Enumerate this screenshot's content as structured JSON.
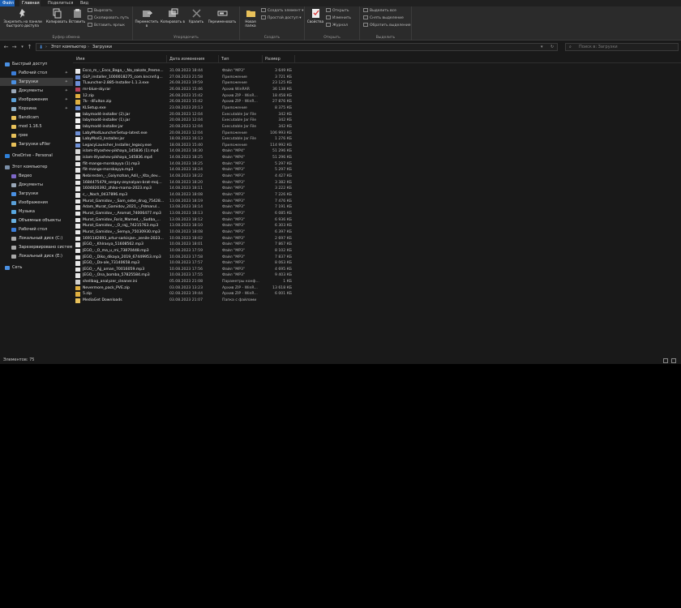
{
  "ribbon_tabs": [
    "Файл",
    "Главная",
    "Поделиться",
    "Вид"
  ],
  "ribbon": {
    "clipboard": {
      "pin_label": "Закрепить на панели быстрого доступа",
      "copy_label": "Копировать",
      "paste_label": "Вставить",
      "cut_label": "Вырезать",
      "copy_path_label": "Скопировать путь",
      "paste_shortcut_label": "Вставить ярлык",
      "group_label": "Буфер обмена"
    },
    "organize": {
      "move_label": "Переместить в",
      "copy_to_label": "Копировать в",
      "delete_label": "Удалить",
      "rename_label": "Переименовать",
      "group_label": "Упорядочить"
    },
    "new": {
      "new_folder_label": "Новая папка",
      "new_item_label": "Создать элемент",
      "easy_access_label": "Простой доступ",
      "group_label": "Создать"
    },
    "open": {
      "properties_label": "Свойства",
      "open_label": "Открыть",
      "edit_label": "Изменить",
      "history_label": "Журнал",
      "group_label": "Открыть"
    },
    "select": {
      "select_all_label": "Выделить все",
      "select_none_label": "Снять выделение",
      "invert_label": "Обратить выделение",
      "group_label": "Выделить"
    }
  },
  "address": {
    "path": [
      "Этот компьютер",
      "Загрузки"
    ],
    "search_placeholder": "Поиск в: Загрузки"
  },
  "nav": {
    "items": [
      {
        "label": "Быстрый доступ",
        "pinned": false
      },
      {
        "label": "Рабочий стол",
        "pinned": true
      },
      {
        "label": "Загрузки",
        "pinned": true
      },
      {
        "label": "Документы",
        "pinned": true
      },
      {
        "label": "Изображения",
        "pinned": true
      },
      {
        "label": "Корзина",
        "pinned": true
      },
      {
        "label": "Bandicam",
        "pinned": false
      },
      {
        "label": "mod 1.16.5",
        "pinned": false
      },
      {
        "label": "rpee",
        "pinned": false
      },
      {
        "label": "Загрузки uFiler",
        "pinned": false
      },
      {
        "label": "OneDrive - Personal",
        "pinned": false
      },
      {
        "label": "Этот компьютер",
        "pinned": false
      },
      {
        "label": "Видео",
        "pinned": false
      },
      {
        "label": "Документы",
        "pinned": false
      },
      {
        "label": "Загрузки",
        "pinned": false
      },
      {
        "label": "Изображения",
        "pinned": false
      },
      {
        "label": "Музыка",
        "pinned": false
      },
      {
        "label": "Объемные объекты",
        "pinned": false
      },
      {
        "label": "Рабочий стол",
        "pinned": false
      },
      {
        "label": "Локальный диск (C:)",
        "pinned": false
      },
      {
        "label": "Зарезервировано систем",
        "pinned": false
      },
      {
        "label": "Локальный диск (E:)",
        "pinned": false
      },
      {
        "label": "Сеть",
        "pinned": false
      }
    ]
  },
  "columns": {
    "name": "Имя",
    "date": "Дата изменения",
    "type": "Тип",
    "size": "Размер"
  },
  "files": [
    {
      "name": "Esco_m_-_Esco_Baga_-_Na_zakate_Preme...",
      "date": "31.08.2023 18:44",
      "type": "Файл \"MP3\"",
      "size": "3 649 КБ",
      "kind": "mp3"
    },
    {
      "name": "GLP_installer_1000018275_com.kncnnf.g...",
      "date": "27.08.2023 21:58",
      "type": "Приложение",
      "size": "3 721 КБ",
      "kind": "exe"
    },
    {
      "name": "TLauncher-2.885-Installer-1.1.3.exe",
      "date": "26.08.2023 19:59",
      "type": "Приложение",
      "size": "23 125 КБ",
      "kind": "exe"
    },
    {
      "name": "mr-blue-sky.rar",
      "date": "26.08.2023 15:46",
      "type": "Архив WinRAR",
      "size": "36 138 КБ",
      "kind": "rar"
    },
    {
      "name": "12.zip",
      "date": "26.08.2023 15:42",
      "type": "Архив ZIP - WinR...",
      "size": "18 458 КБ",
      "kind": "zip"
    },
    {
      "name": "7k- -4Fulton.zip",
      "date": "26.08.2023 15:42",
      "type": "Архив ZIP - WinR...",
      "size": "27 876 КБ",
      "kind": "zip"
    },
    {
      "name": "KLSetup.exe",
      "date": "23.08.2023 20:13",
      "type": "Приложение",
      "size": "8 375 КБ",
      "kind": "exe"
    },
    {
      "name": "labymod4-installer (2).jar",
      "date": "20.08.2023 12:04",
      "type": "Executable Jar File",
      "size": "342 КБ",
      "kind": "jar"
    },
    {
      "name": "labymod4-installer (1).jar",
      "date": "20.08.2023 12:04",
      "type": "Executable Jar File",
      "size": "342 КБ",
      "kind": "jar"
    },
    {
      "name": "labymod4-installer.jar",
      "date": "20.08.2023 12:04",
      "type": "Executable Jar File",
      "size": "342 КБ",
      "kind": "jar"
    },
    {
      "name": "LabyModLauncherSetup-latest.exe",
      "date": "20.08.2023 12:04",
      "type": "Приложение",
      "size": "106 993 КБ",
      "kind": "exe"
    },
    {
      "name": "LabyMod3_Installer.jar",
      "date": "18.08.2023 16:13",
      "type": "Executable Jar File",
      "size": "1 276 КБ",
      "kind": "jar"
    },
    {
      "name": "LegacyLauncher_Installer_legacy.exe",
      "date": "18.08.2023 15:40",
      "type": "Приложение",
      "size": "114 992 КБ",
      "kind": "exe"
    },
    {
      "name": "islam-itlyashev-pikhaya_145836 (1).mp4",
      "date": "14.08.2023 18:30",
      "type": "Файл \"MP4\"",
      "size": "51 296 КБ",
      "kind": "mp4"
    },
    {
      "name": "islam-itlyashev-pikhaya_145836.mp4",
      "date": "14.08.2023 18:25",
      "type": "Файл \"MP4\"",
      "size": "51 296 КБ",
      "kind": "mp4"
    },
    {
      "name": "flit-mango-morskayya (1).mp3",
      "date": "14.08.2023 18:25",
      "type": "Файл \"MP3\"",
      "size": "5 297 КБ",
      "kind": "mp3"
    },
    {
      "name": "flit-mango-morskayya.mp3",
      "date": "14.08.2023 18:24",
      "type": "Файл \"MP3\"",
      "size": "5 297 КБ",
      "kind": "mp3"
    },
    {
      "name": "Nebiresten_-_Galymzhan_Adil_-_Kta_dev...",
      "date": "14.08.2023 18:22",
      "type": "Файл \"MP3\"",
      "size": "4 427 КБ",
      "kind": "mp3"
    },
    {
      "name": "1684475479_sergey-zeynalyan-brat-moj...",
      "date": "14.08.2023 18:20",
      "type": "Файл \"MP3\"",
      "size": "3 382 КБ",
      "kind": "mp3"
    },
    {
      "name": "1604820392_zhiko-mama-2023.mp3",
      "date": "14.08.2023 18:11",
      "type": "Файл \"MP3\"",
      "size": "3 222 КБ",
      "kind": "mp3"
    },
    {
      "name": "c_-_Noch_0437896.mp3",
      "date": "14.08.2023 18:08",
      "type": "Файл \"MP3\"",
      "size": "7 226 КБ",
      "kind": "mp3"
    },
    {
      "name": "Murat_Gamidov_-_Sam_sebe_drug_75428...",
      "date": "13.08.2023 18:19",
      "type": "Файл \"MP3\"",
      "size": "7 476 КБ",
      "kind": "mp3"
    },
    {
      "name": "Adam_Murat_Gamidov_2021_-_Pdmarul...",
      "date": "13.08.2023 18:14",
      "type": "Файл \"MP3\"",
      "size": "7 191 КБ",
      "kind": "mp3"
    },
    {
      "name": "Murat_Gamidov_-_Aromat_74006477.mp3",
      "date": "13.08.2023 18:13",
      "type": "Файл \"MP3\"",
      "size": "6 085 КБ",
      "kind": "mp3"
    },
    {
      "name": "Murat_Gamidov_Fariz_Mamed_-_Sudba_...",
      "date": "13.08.2023 18:12",
      "type": "Файл \"MP3\"",
      "size": "6 936 КБ",
      "kind": "mp3"
    },
    {
      "name": "Murat_Gamidov_-_O_rajj_74215763.mp3",
      "date": "13.08.2023 18:10",
      "type": "Файл \"MP3\"",
      "size": "6 303 КБ",
      "kind": "mp3"
    },
    {
      "name": "Murat_Gamidov_-_Semya_75030930.mp3",
      "date": "10.08.2023 18:08",
      "type": "Файл \"MP3\"",
      "size": "6 397 КБ",
      "kind": "mp3"
    },
    {
      "name": "1691142693_artur-sarkisjan-_zenile-2023...",
      "date": "10.08.2023 18:02",
      "type": "Файл \"MP3\"",
      "size": "2 697 КБ",
      "kind": "mp3"
    },
    {
      "name": "JEGO_-_Khlrasya_51608562.mp3",
      "date": "10.08.2023 18:01",
      "type": "Файл \"MP3\"",
      "size": "7 867 КБ",
      "kind": "mp3"
    },
    {
      "name": "JEGO_-_O_ma_u_mi_73870448.mp3",
      "date": "10.08.2023 17:59",
      "type": "Файл \"MP3\"",
      "size": "8 102 КБ",
      "kind": "mp3"
    },
    {
      "name": "JEGO_-_Diko_dikaya_2019_67449953.mp3",
      "date": "10.08.2023 17:58",
      "type": "Файл \"MP3\"",
      "size": "7 837 КБ",
      "kind": "mp3"
    },
    {
      "name": "JEGO_-_Da-ale_73140658.mp3",
      "date": "10.08.2023 17:57",
      "type": "Файл \"MP3\"",
      "size": "8 063 КБ",
      "kind": "mp3"
    },
    {
      "name": "JEGO_-_Ajj_aman_70016059.mp3",
      "date": "10.08.2023 17:56",
      "type": "Файл \"MP3\"",
      "size": "4 695 КБ",
      "kind": "mp3"
    },
    {
      "name": "JEGO_-_Ona_bomba_57825584.mp3",
      "date": "10.08.2023 17:55",
      "type": "Файл \"MP3\"",
      "size": "9 403 КБ",
      "kind": "mp3"
    },
    {
      "name": "shellbag_analyzer_cleaner.ini",
      "date": "05.08.2023 21:08",
      "type": "Параметры конф...",
      "size": "1 КБ",
      "kind": "ini"
    },
    {
      "name": "Nevermore_pack_PVE.zip",
      "date": "03.08.2023 13:23",
      "type": "Архив ZIP - WinR...",
      "size": "13 618 КБ",
      "kind": "zip"
    },
    {
      "name": "5.zip",
      "date": "02.08.2023 19:44",
      "type": "Архив ZIP - WinR...",
      "size": "6 001 КБ",
      "kind": "zip"
    },
    {
      "name": "MediaGet Downloads",
      "date": "03.08.2023 21:07",
      "type": "Папка с файлами",
      "size": "",
      "kind": "folder"
    }
  ],
  "status": {
    "items_count": "Элементов: 75"
  },
  "colors": {
    "accent": "#1a5fb4",
    "background": "#191919",
    "ribbon": "#2b2b2b"
  }
}
